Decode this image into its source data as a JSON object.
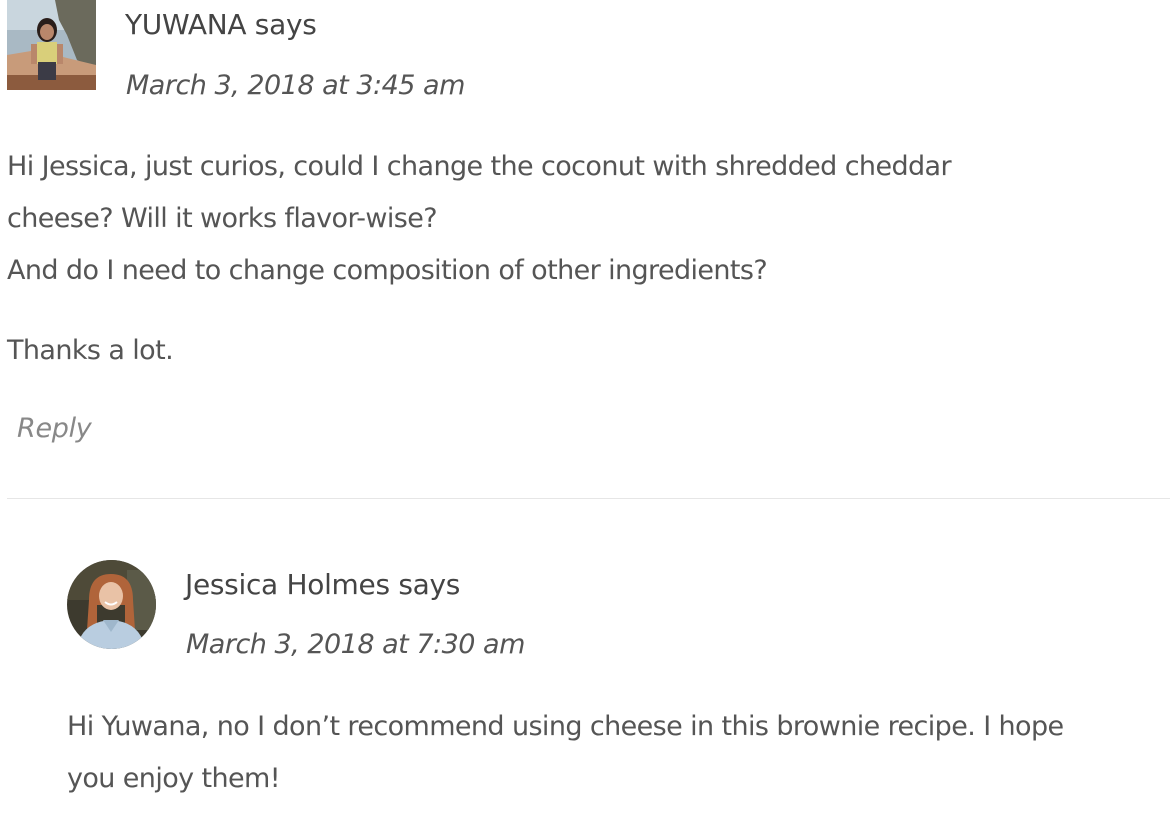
{
  "comments": [
    {
      "author": "YUWANA says",
      "date": "March 3, 2018 at 3:45 am",
      "avatar": "photo-avatar-woman-outdoors",
      "lines": [
        "Hi Jessica, just curios, could I change the coconut with shredded cheddar",
        "cheese? Will it works flavor-wise?",
        "And do I need to change composition of other ingredients?"
      ],
      "closing": "Thanks a lot.",
      "reply_label": "Reply"
    },
    {
      "author": "Jessica Holmes says",
      "date": "March 3, 2018 at 7:30 am",
      "avatar": "photo-avatar-woman-smiling",
      "lines": [
        "Hi Yuwana, no I don’t recommend using cheese in this brownie recipe. I hope",
        "you enjoy them!"
      ]
    }
  ],
  "colors": {
    "text": "#555555",
    "author": "#444444",
    "reply": "#888888",
    "divider": "#e6e6e6"
  }
}
